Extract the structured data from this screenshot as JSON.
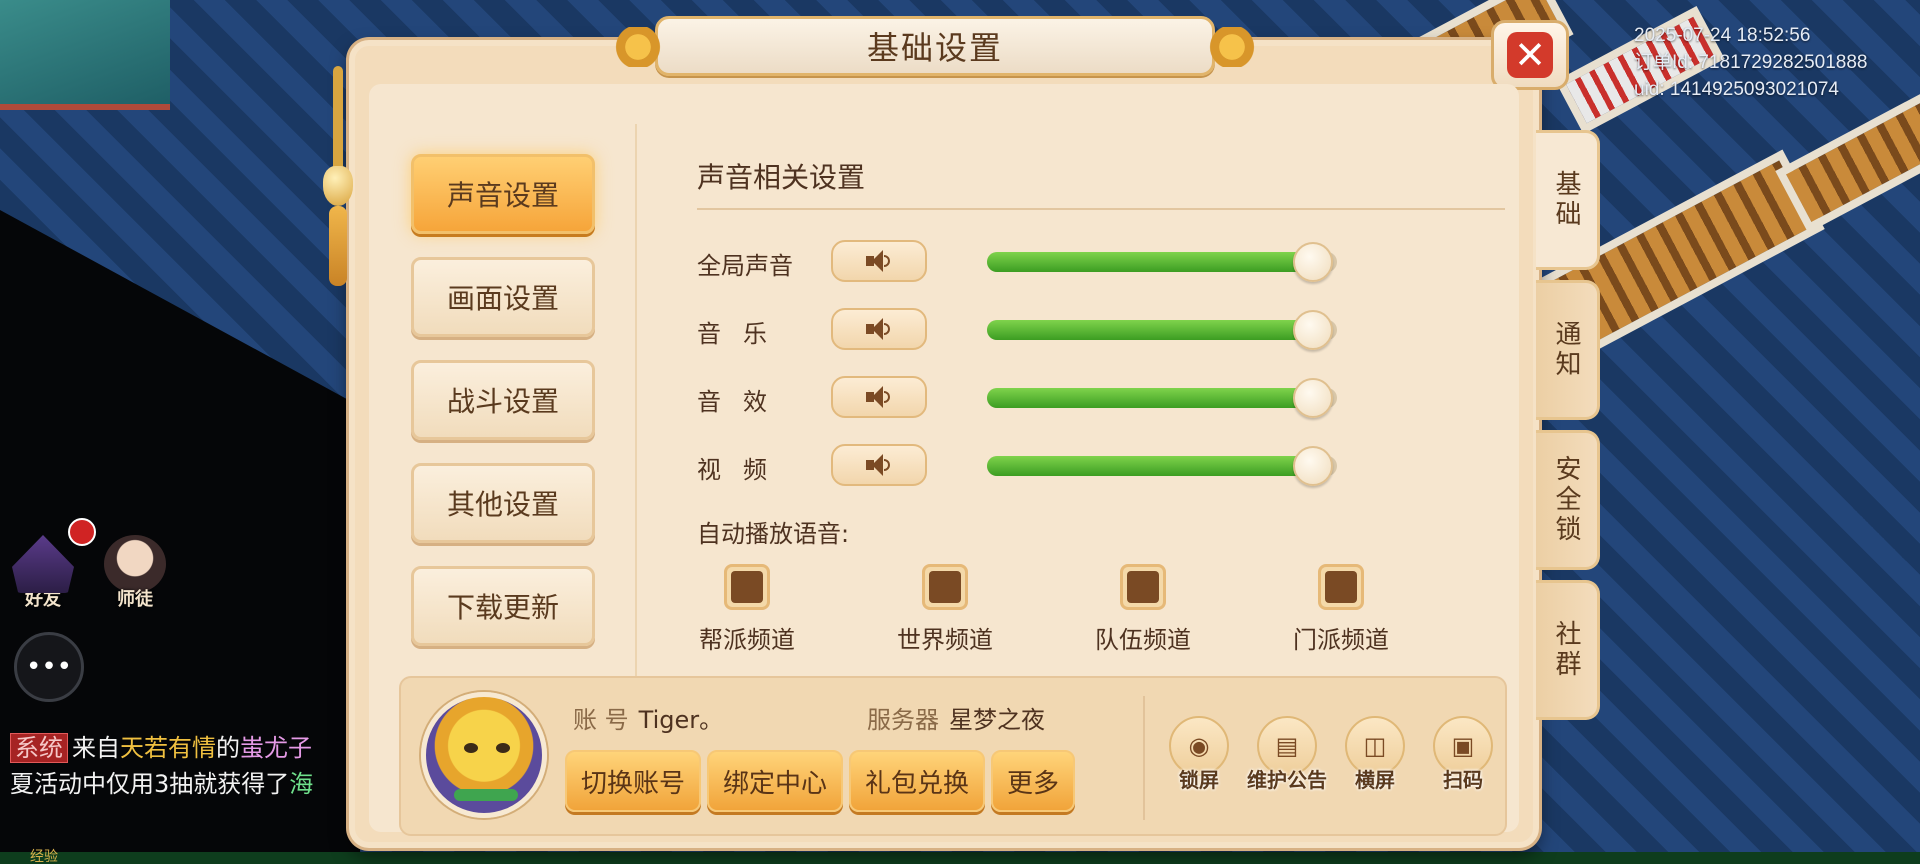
{
  "overlay": {
    "datetime": "2025-07-24 18:52:56",
    "order_id": "订单Id: 7181729282501888",
    "uid": "uid: 1414925093021074"
  },
  "hud": {
    "friend_label": "好友",
    "master_label": "师徒"
  },
  "chat": {
    "tag": "系统",
    "line1_a": "来自",
    "line1_name1": "天若有情",
    "line1_b": "的",
    "line1_name2": "蚩尤子",
    "line2_a": "夏活动中仅用3抽就获得了",
    "line2_name": "海"
  },
  "bottom": {
    "exp_label": "经验"
  },
  "panel": {
    "title": "基础设置",
    "close_label": "✕",
    "categories": [
      {
        "label": "声音设置",
        "active": true
      },
      {
        "label": "画面设置",
        "active": false
      },
      {
        "label": "战斗设置",
        "active": false
      },
      {
        "label": "其他设置",
        "active": false
      },
      {
        "label": "下载更新",
        "active": false
      }
    ],
    "section_title": "声音相关设置",
    "volumes": [
      {
        "label": "全局声音",
        "level": 0.93
      },
      {
        "label": "音乐",
        "level": 0.93
      },
      {
        "label": "音效",
        "level": 0.93
      },
      {
        "label": "视频",
        "level": 0.93
      }
    ],
    "auto_play_label": "自动播放语音:",
    "channels": [
      {
        "label": "帮派频道",
        "checked": true
      },
      {
        "label": "世界频道",
        "checked": true
      },
      {
        "label": "队伍频道",
        "checked": true
      },
      {
        "label": "门派频道",
        "checked": true
      }
    ],
    "account": {
      "id_label": "账 号",
      "id_value": "Tiger。",
      "server_label": "服务器",
      "server_value": "星梦之夜",
      "buttons": [
        "切换账号",
        "绑定中心",
        "礼包兑换",
        "更多"
      ],
      "tools": [
        {
          "label": "锁屏",
          "icon": "lock-icon"
        },
        {
          "label": "维护公告",
          "icon": "notice-icon"
        },
        {
          "label": "横屏",
          "icon": "rotate-icon"
        },
        {
          "label": "扫码",
          "icon": "scan-icon"
        }
      ]
    },
    "side_tabs": [
      {
        "label": "基础",
        "active": true
      },
      {
        "label": "通知",
        "active": false
      },
      {
        "label": "安全锁",
        "active": false
      },
      {
        "label": "社群",
        "active": false
      }
    ]
  }
}
